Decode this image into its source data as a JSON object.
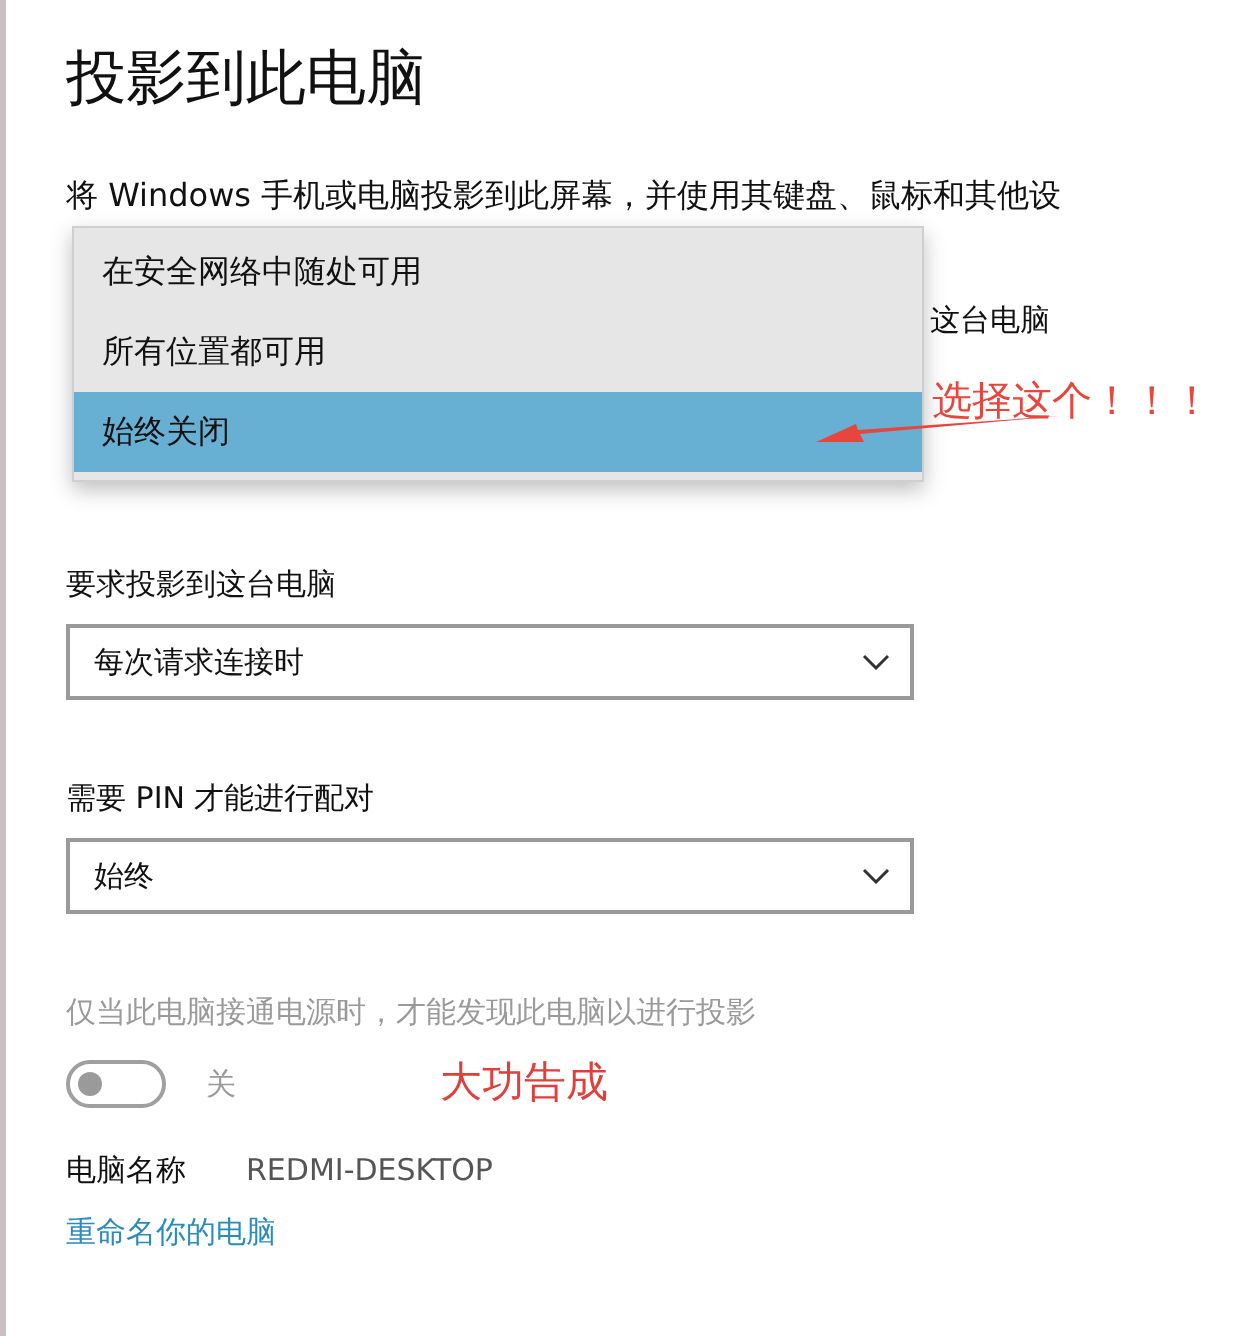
{
  "title": "投影到此电脑",
  "description": "将 Windows 手机或电脑投影到此屏幕，并使用其键盘、鼠标和其他设",
  "covered_label": "这台电脑",
  "dropdown_menu": [
    {
      "label": "在安全网络中随处可用",
      "selected": false
    },
    {
      "label": "所有位置都可用",
      "selected": false
    },
    {
      "label": "始终关闭",
      "selected": true
    }
  ],
  "selects": [
    {
      "label": "要求投影到这台电脑",
      "value": "每次请求连接时"
    },
    {
      "label": "需要 PIN 才能进行配对",
      "value": "始终"
    }
  ],
  "power_setting": {
    "label": "仅当此电脑接通电源时，才能发现此电脑以进行投影",
    "disabled": true,
    "on": false,
    "state_text": "关"
  },
  "pc_name": {
    "label": "电脑名称",
    "value": "REDMI-DESKTOP"
  },
  "rename_link": "重命名你的电脑",
  "annotations": [
    {
      "kind": "arrow",
      "text": "选择这个！！！"
    },
    {
      "kind": "note",
      "text": "大功告成"
    }
  ]
}
